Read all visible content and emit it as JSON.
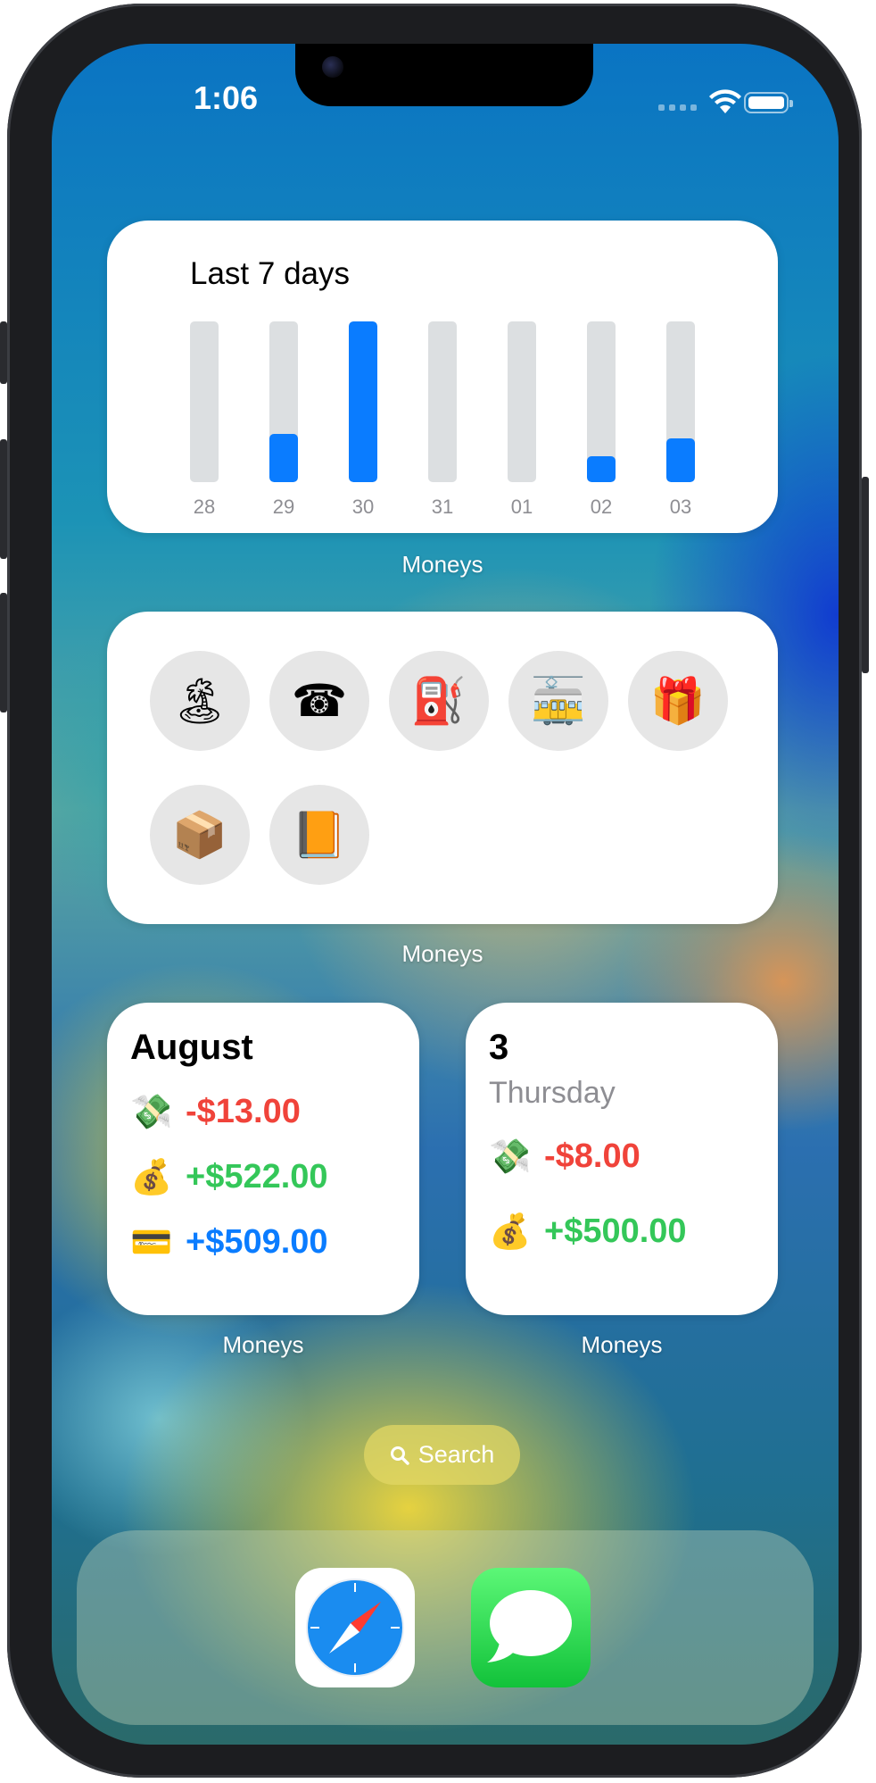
{
  "status_bar": {
    "time": "1:06"
  },
  "chart_widget": {
    "title": "Last 7 days",
    "app_label": "Moneys",
    "accent_color": "#0a7cff",
    "track_color": "#dcdfe1"
  },
  "chart_data": {
    "type": "bar",
    "title": "Last 7 days",
    "xlabel": "",
    "ylabel": "",
    "categories": [
      "28",
      "29",
      "30",
      "31",
      "01",
      "02",
      "03"
    ],
    "values": [
      0,
      0.3,
      1.0,
      0,
      0,
      0.16,
      0.27
    ],
    "ylim": [
      0,
      1
    ],
    "grid": false
  },
  "categories_widget": {
    "app_label": "Moneys",
    "items": [
      {
        "icon": "palm-tree-icon",
        "glyph": "🏝"
      },
      {
        "icon": "telephone-icon",
        "glyph": "☎"
      },
      {
        "icon": "fuel-pump-icon",
        "glyph": "⛽"
      },
      {
        "icon": "tram-icon",
        "glyph": "🚋"
      },
      {
        "icon": "gift-icon",
        "glyph": "🎁"
      },
      {
        "icon": "package-icon",
        "glyph": "📦"
      },
      {
        "icon": "notebook-icon",
        "glyph": "📙"
      }
    ]
  },
  "month_widget": {
    "title": "August",
    "app_label": "Moneys",
    "rows": [
      {
        "icon": "money-with-wings-icon",
        "glyph": "💸",
        "amount": "-$13.00"
      },
      {
        "icon": "money-bag-icon",
        "glyph": "💰",
        "amount": "+$522.00"
      },
      {
        "icon": "credit-card-icon",
        "glyph": "💳",
        "amount": "+$509.00"
      }
    ]
  },
  "day_widget": {
    "day": "3",
    "weekday": "Thursday",
    "app_label": "Moneys",
    "rows": [
      {
        "icon": "money-with-wings-icon",
        "glyph": "💸",
        "amount": "-$8.00"
      },
      {
        "icon": "money-bag-icon",
        "glyph": "💰",
        "amount": "+$500.00"
      }
    ]
  },
  "search": {
    "label": "Search"
  },
  "dock": {
    "apps": [
      {
        "icon": "safari-icon"
      },
      {
        "icon": "messages-icon"
      }
    ]
  }
}
